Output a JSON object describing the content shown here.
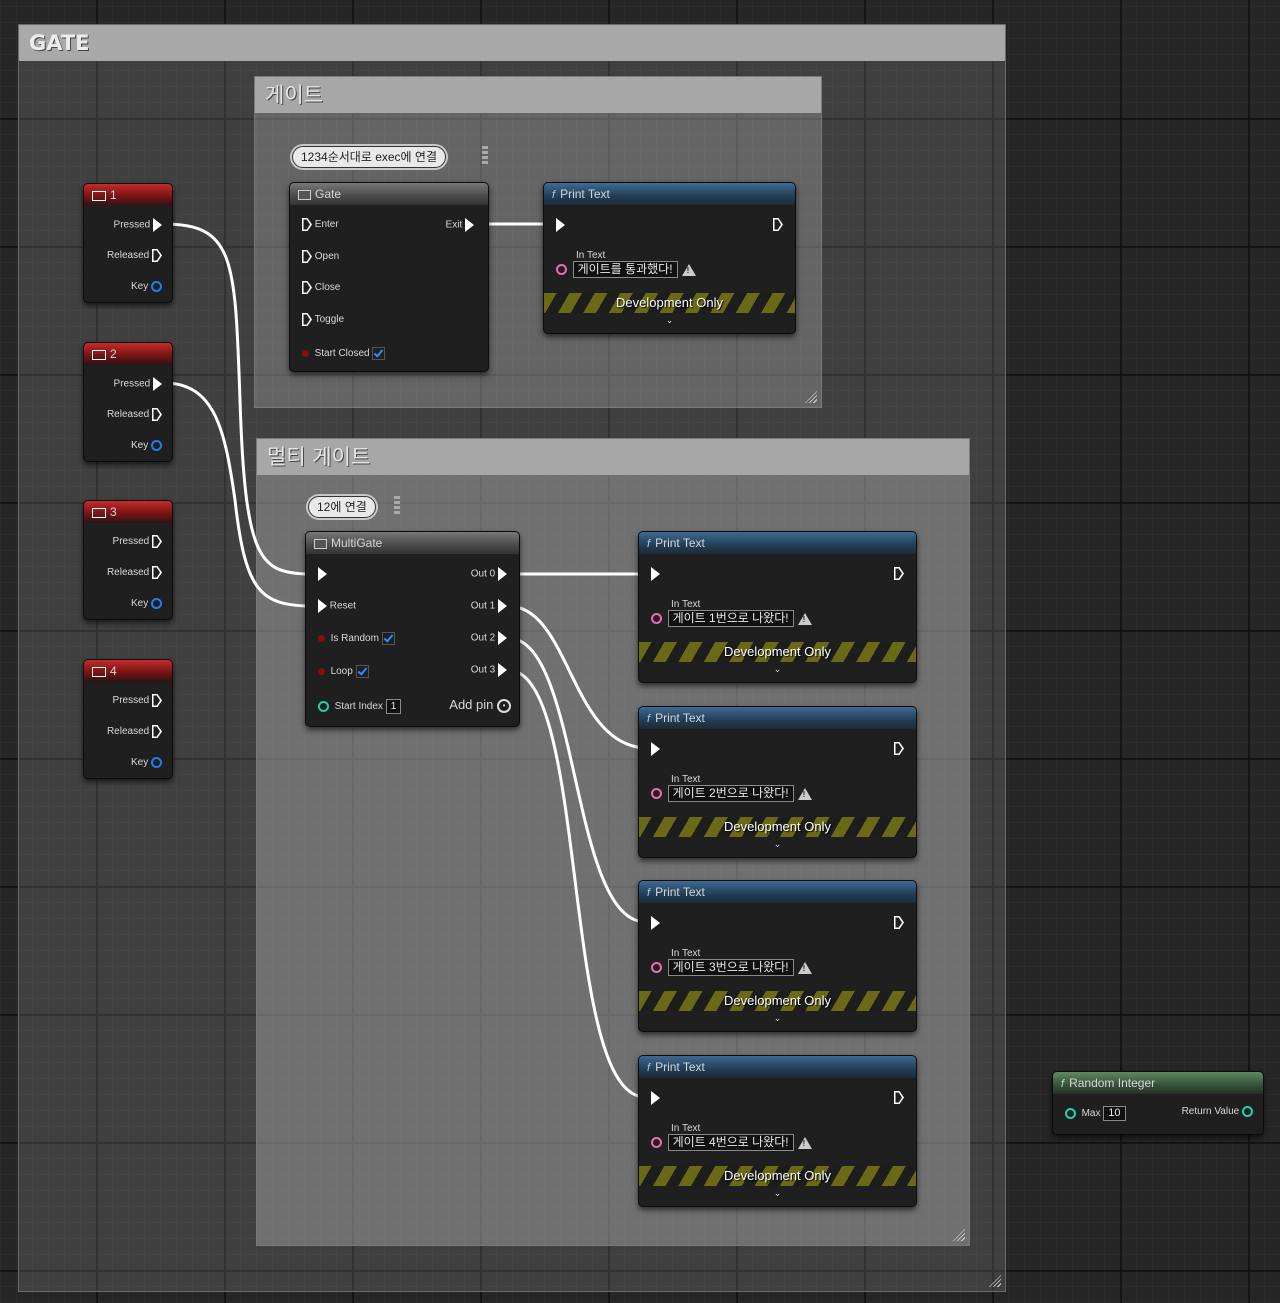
{
  "outer_comment": {
    "title": "GATE"
  },
  "gate_comment": {
    "title": "게이트",
    "bubble": "1234순서대로 exec에 연결"
  },
  "multigate_comment": {
    "title": "멀티 게이트",
    "bubble": "12에 연결"
  },
  "key_nodes": [
    {
      "title": "1",
      "pressed": "Pressed",
      "released": "Released",
      "key": "Key"
    },
    {
      "title": "2",
      "pressed": "Pressed",
      "released": "Released",
      "key": "Key"
    },
    {
      "title": "3",
      "pressed": "Pressed",
      "released": "Released",
      "key": "Key"
    },
    {
      "title": "4",
      "pressed": "Pressed",
      "released": "Released",
      "key": "Key"
    }
  ],
  "gate_node": {
    "title": "Gate",
    "enter": "Enter",
    "open": "Open",
    "close": "Close",
    "toggle": "Toggle",
    "start_closed": "Start Closed",
    "exit": "Exit"
  },
  "multigate_node": {
    "title": "MultiGate",
    "reset": "Reset",
    "is_random": "Is Random",
    "loop": "Loop",
    "start_index_label": "Start Index",
    "start_index_value": "1",
    "out0": "Out 0",
    "out1": "Out 1",
    "out2": "Out 2",
    "out3": "Out 3",
    "add_pin": "Add pin"
  },
  "print_nodes": [
    {
      "title": "Print Text",
      "in_text_label": "In Text",
      "value": "게이트를 통과했다!",
      "dev": "Development Only"
    },
    {
      "title": "Print Text",
      "in_text_label": "In Text",
      "value": "게이트 1번으로 나왔다!",
      "dev": "Development Only"
    },
    {
      "title": "Print Text",
      "in_text_label": "In Text",
      "value": "게이트 2번으로 나왔다!",
      "dev": "Development Only"
    },
    {
      "title": "Print Text",
      "in_text_label": "In Text",
      "value": "게이트 3번으로 나왔다!",
      "dev": "Development Only"
    },
    {
      "title": "Print Text",
      "in_text_label": "In Text",
      "value": "게이트 4번으로 나왔다!",
      "dev": "Development Only"
    }
  ],
  "random_node": {
    "title": "Random Integer",
    "max_label": "Max",
    "max_value": "10",
    "return_label": "Return Value"
  },
  "colors": {
    "exec_wire": "#ffffff",
    "event_header": "#c42b2b",
    "function_header": "#3e6a93",
    "pure_header": "#5e8a5e"
  }
}
